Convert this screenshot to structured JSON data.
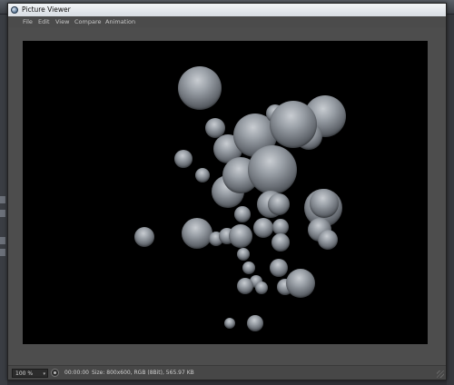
{
  "window": {
    "title": "Picture Viewer",
    "icon": "picture-viewer-app-icon"
  },
  "menu": [
    {
      "label": "File"
    },
    {
      "label": "Edit"
    },
    {
      "label": "View"
    },
    {
      "label": "Compare"
    },
    {
      "label": "Animation"
    }
  ],
  "status": {
    "zoom": "100 %",
    "timecode": "00:00:00",
    "info": "Size: 800x600, RGB (8Bit), 565.97 KB"
  },
  "render": {
    "description_icon": "rendered-spheres-image",
    "background_color": "#000000",
    "sphere_color": "#9aa0a7"
  }
}
